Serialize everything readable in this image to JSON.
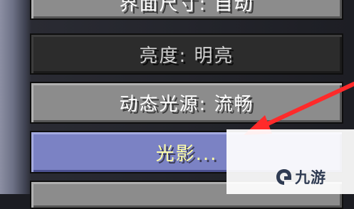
{
  "menu": {
    "buttons": [
      {
        "label": "界面尺寸: 自动",
        "state": "normal"
      },
      {
        "label": "亮度: 明亮",
        "state": "disabled"
      },
      {
        "label": "动态光源: 流畅",
        "state": "normal"
      },
      {
        "label": "光影...",
        "state": "hover"
      },
      {
        "label": "",
        "state": "normal"
      }
    ]
  },
  "annotation": {
    "arrow_color": "#ff2a2a"
  },
  "watermark": {
    "text": "九游",
    "color": "#2f3b52",
    "icon": "jiuyou-logo-icon"
  }
}
